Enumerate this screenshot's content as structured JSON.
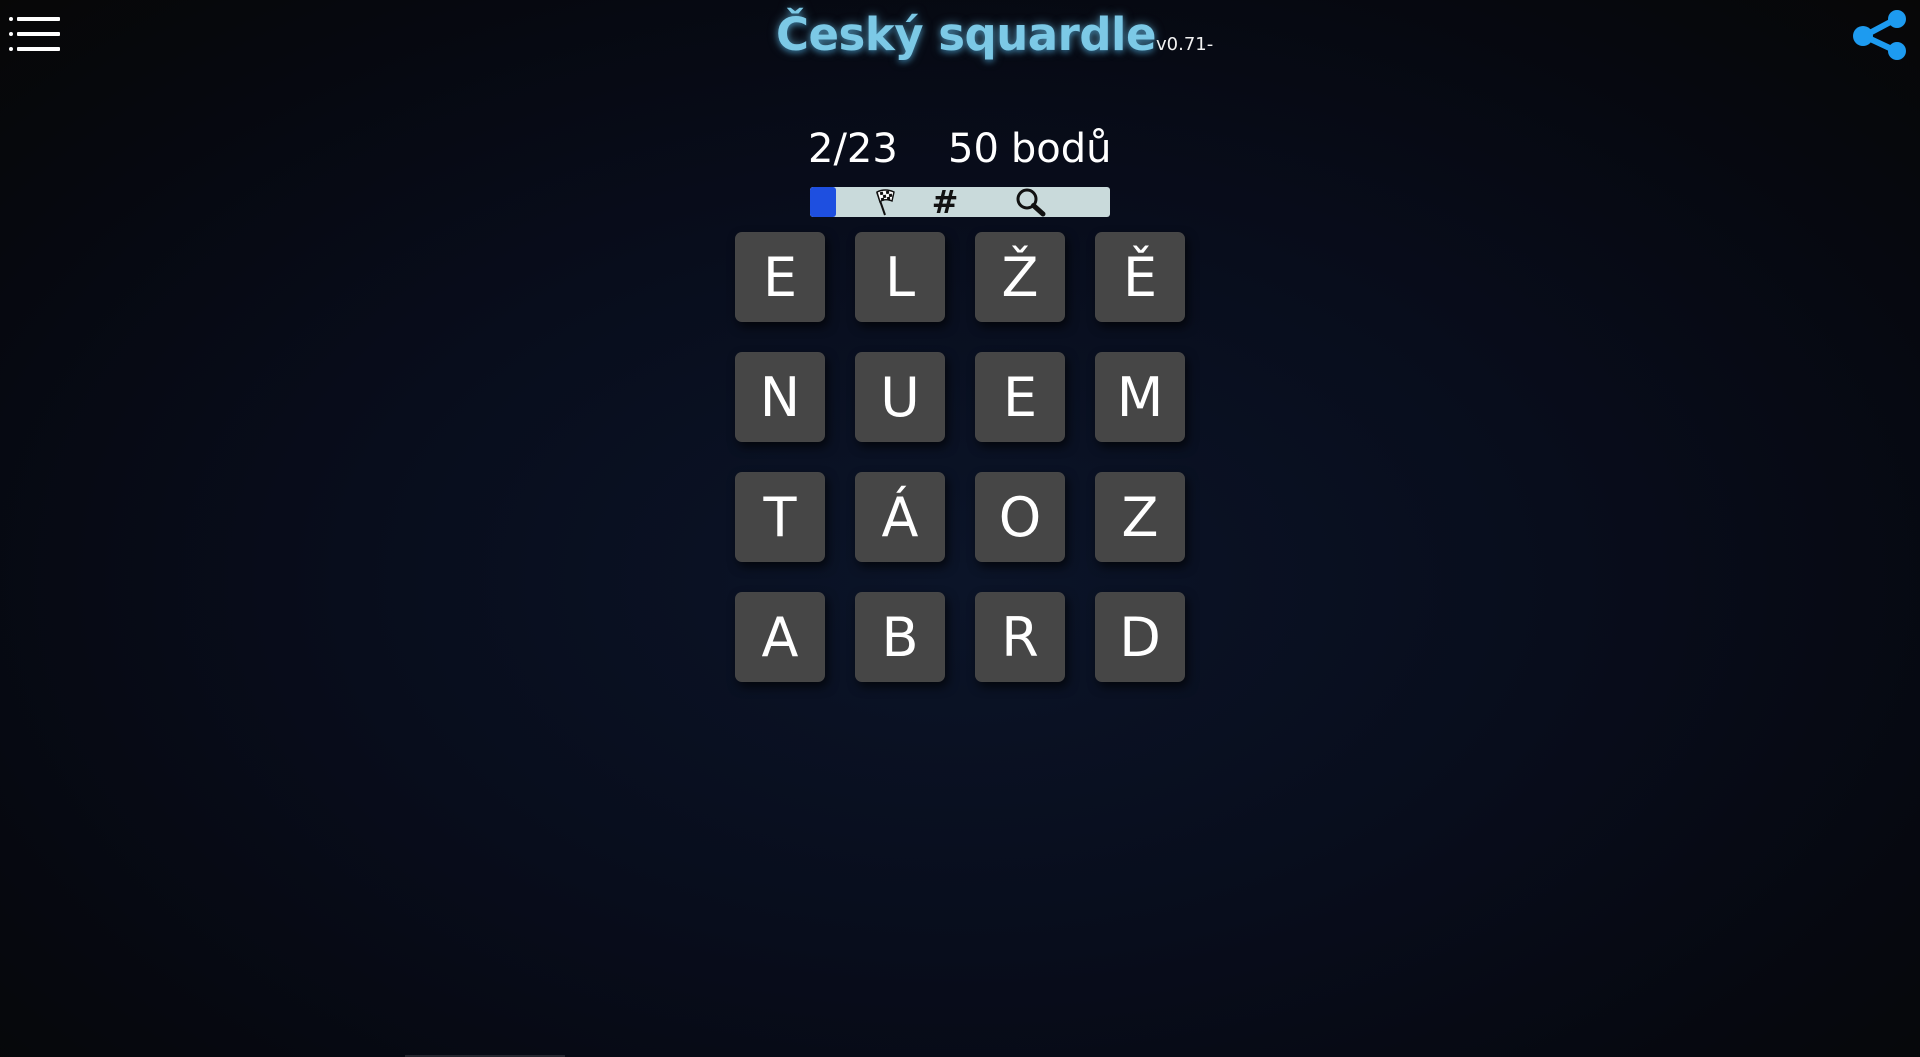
{
  "header": {
    "title": "Český squardle",
    "version": "v0.71-",
    "menu_icon": "list-menu-icon",
    "share_icon": "share-icon",
    "accent_color": "#7cc9e6",
    "share_color": "#1d9bf0"
  },
  "stats": {
    "found": "2/23",
    "points_value": "50",
    "points_label": "bodů"
  },
  "progress": {
    "fraction": 0.087,
    "fill_color": "#1e4fe0",
    "track_color": "#c9dadb",
    "milestones": [
      {
        "icon": "checkered-flag-icon"
      },
      {
        "icon": "hash-icon",
        "glyph": "#"
      },
      {
        "icon": "magnifier-icon"
      }
    ]
  },
  "board": {
    "tile_color": "#464646",
    "rows": [
      [
        "E",
        "L",
        "Ž",
        "Ě"
      ],
      [
        "N",
        "U",
        "E",
        "M"
      ],
      [
        "T",
        "Á",
        "O",
        "Z"
      ],
      [
        "A",
        "B",
        "R",
        "D"
      ]
    ]
  }
}
